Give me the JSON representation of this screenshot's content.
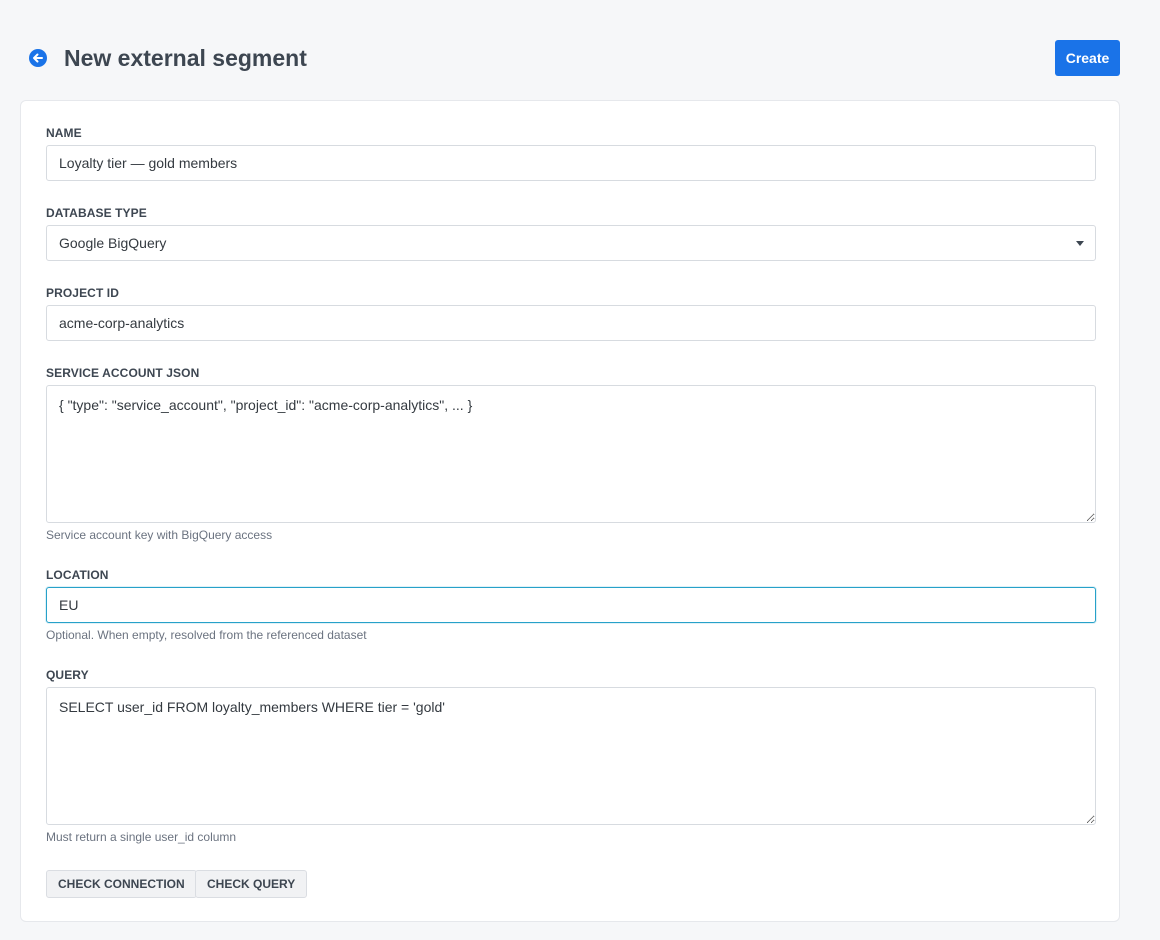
{
  "header": {
    "title": "New external segment",
    "create_label": "Create"
  },
  "form": {
    "name": {
      "label": "NAME",
      "value": "Loyalty tier — gold members"
    },
    "database_type": {
      "label": "DATABASE TYPE",
      "selected": "Google BigQuery"
    },
    "project_id": {
      "label": "PROJECT ID",
      "value": "acme-corp-analytics"
    },
    "service_account": {
      "label": "SERVICE ACCOUNT JSON",
      "value": "{ \"type\": \"service_account\", \"project_id\": \"acme-corp-analytics\", ... }",
      "help": "Service account key with BigQuery access"
    },
    "location": {
      "label": "LOCATION",
      "value": "EU",
      "help": "Optional. When empty, resolved from the referenced dataset"
    },
    "query": {
      "label": "QUERY",
      "value": "SELECT user_id FROM loyalty_members WHERE tier = 'gold'",
      "help": "Must return a single user_id column"
    }
  },
  "actions": {
    "check_connection": "CHECK CONNECTION",
    "check_query": "CHECK QUERY"
  },
  "colors": {
    "accent": "#1a73e8",
    "focus_border": "#26a1c9",
    "page_background": "#f6f7f9"
  },
  "icons": {
    "back": "arrow-left-circle-icon",
    "select_caret": "caret-down-icon"
  }
}
